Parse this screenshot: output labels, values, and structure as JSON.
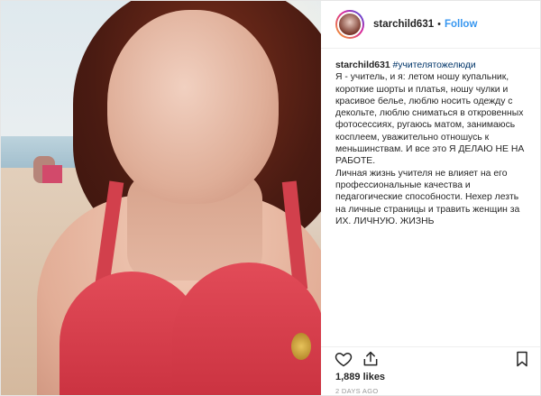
{
  "post": {
    "username": "starchild631",
    "follow_label": "Follow",
    "separator": "•",
    "caption_user": "starchild631",
    "hashtag": "#учителятожелюди",
    "caption_paragraphs": [
      "Я - учитель, и я: летом ношу купальник, короткие шорты и платья, ношу чулки и красивое белье, люблю носить одежду с декольте, люблю сниматься в откровенных фотосессиях, ругаюсь матом, занимаюсь косплеем, уважительно отношусь к меньшинствам. И все это Я ДЕЛАЮ НЕ НА РАБОТЕ.",
      "Личная жизнь учителя не влияет на его профессиональные качества и педагогические способности. Нехер лезть на личные страницы и травить женщин за ИХ. ЛИЧНУЮ. ЖИЗНЬ"
    ],
    "likes": "1,889 likes",
    "time_ago": "2 DAYS AGO"
  },
  "icons": {
    "like": "heart-outline-icon",
    "share": "share-upload-icon",
    "save": "bookmark-outline-icon"
  }
}
